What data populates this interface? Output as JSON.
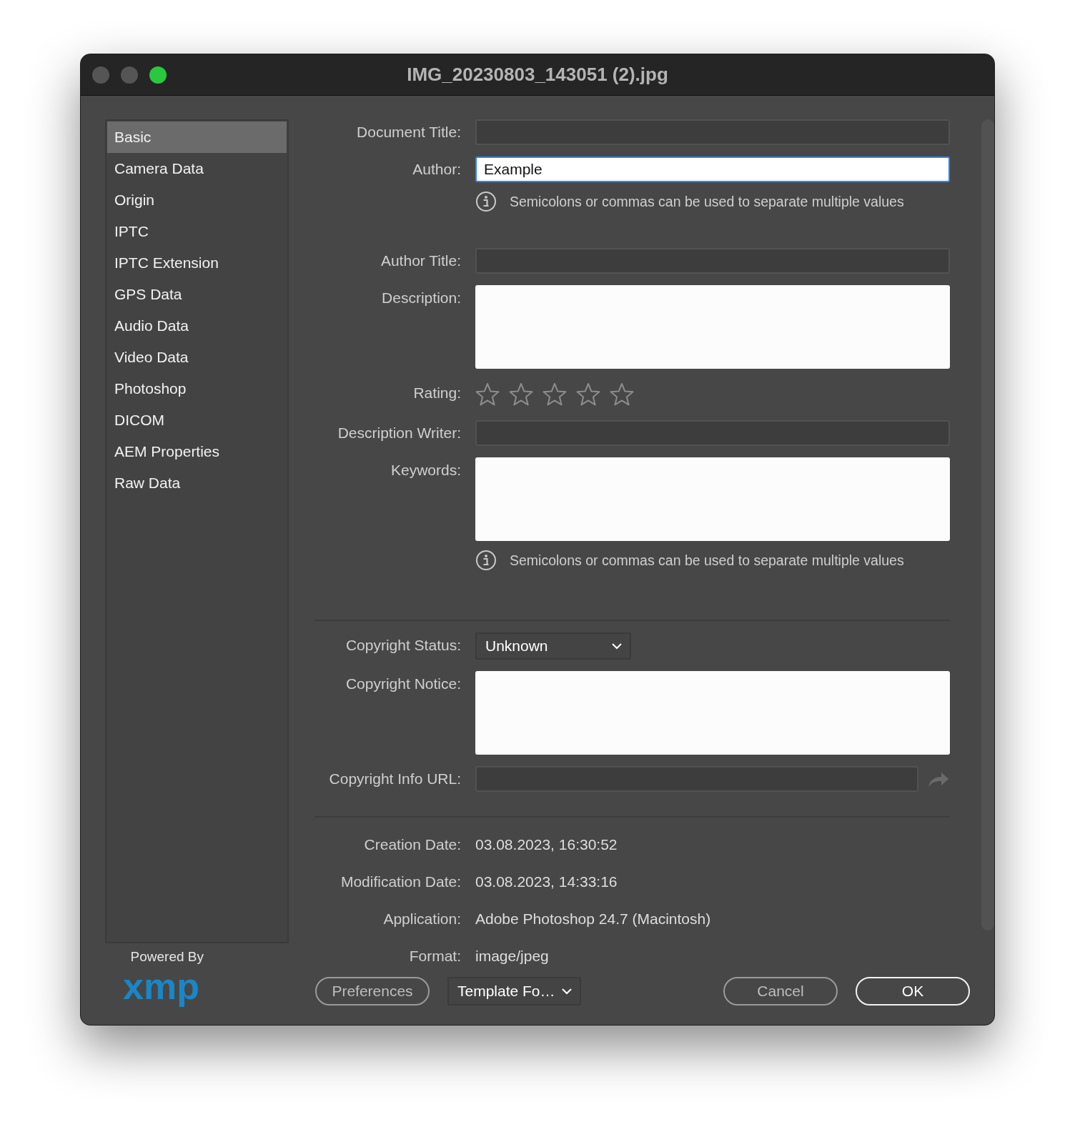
{
  "window": {
    "title": "IMG_20230803_143051 (2).jpg"
  },
  "sidebar": {
    "items": [
      {
        "label": "Basic",
        "selected": true
      },
      {
        "label": "Camera Data",
        "selected": false
      },
      {
        "label": "Origin",
        "selected": false
      },
      {
        "label": "IPTC",
        "selected": false
      },
      {
        "label": "IPTC Extension",
        "selected": false
      },
      {
        "label": "GPS Data",
        "selected": false
      },
      {
        "label": "Audio Data",
        "selected": false
      },
      {
        "label": "Video Data",
        "selected": false
      },
      {
        "label": "Photoshop",
        "selected": false
      },
      {
        "label": "DICOM",
        "selected": false
      },
      {
        "label": "AEM Properties",
        "selected": false
      },
      {
        "label": "Raw Data",
        "selected": false
      }
    ]
  },
  "form": {
    "rows": [
      {
        "kind": "text",
        "label": "Document Title:",
        "focused": false
      },
      {
        "kind": "text",
        "label": "Author:",
        "value": "Example",
        "focused": true
      },
      {
        "kind": "hint",
        "text": "Semicolons or commas can be used to separate multiple values"
      },
      {
        "kind": "text",
        "label": "Author Title:",
        "focused": false
      },
      {
        "kind": "textarea",
        "label": "Description:"
      },
      {
        "kind": "rating",
        "label": "Rating:",
        "stars": 0
      },
      {
        "kind": "text",
        "label": "Description Writer:",
        "focused": false
      },
      {
        "kind": "textarea",
        "label": "Keywords:"
      },
      {
        "kind": "hint",
        "text": "Semicolons or commas can be used to separate multiple values"
      },
      {
        "kind": "divider"
      },
      {
        "kind": "dropdown",
        "label": "Copyright Status:",
        "value": "Unknown"
      },
      {
        "kind": "textarea",
        "label": "Copyright Notice:"
      },
      {
        "kind": "url",
        "label": "Copyright Info URL:"
      },
      {
        "kind": "divider"
      },
      {
        "kind": "info",
        "label": "Creation Date:",
        "value": "03.08.2023, 16:30:52"
      },
      {
        "kind": "info",
        "label": "Modification Date:",
        "value": "03.08.2023, 14:33:16"
      },
      {
        "kind": "info",
        "label": "Application:",
        "value": "Adobe Photoshop 24.7 (Macintosh)"
      },
      {
        "kind": "info",
        "label": "Format:",
        "value": "image/jpeg"
      }
    ]
  },
  "footer": {
    "logo": {
      "caption": "Powered By",
      "wordmark": "xmp"
    },
    "buttons": [
      {
        "kind": "button",
        "label": "Preferences",
        "default": false
      },
      {
        "kind": "menu",
        "label": "Template Fo…"
      },
      {
        "kind": "spacer"
      },
      {
        "kind": "button",
        "label": "Cancel",
        "default": false
      },
      {
        "kind": "button",
        "label": "OK",
        "default": true
      }
    ]
  }
}
